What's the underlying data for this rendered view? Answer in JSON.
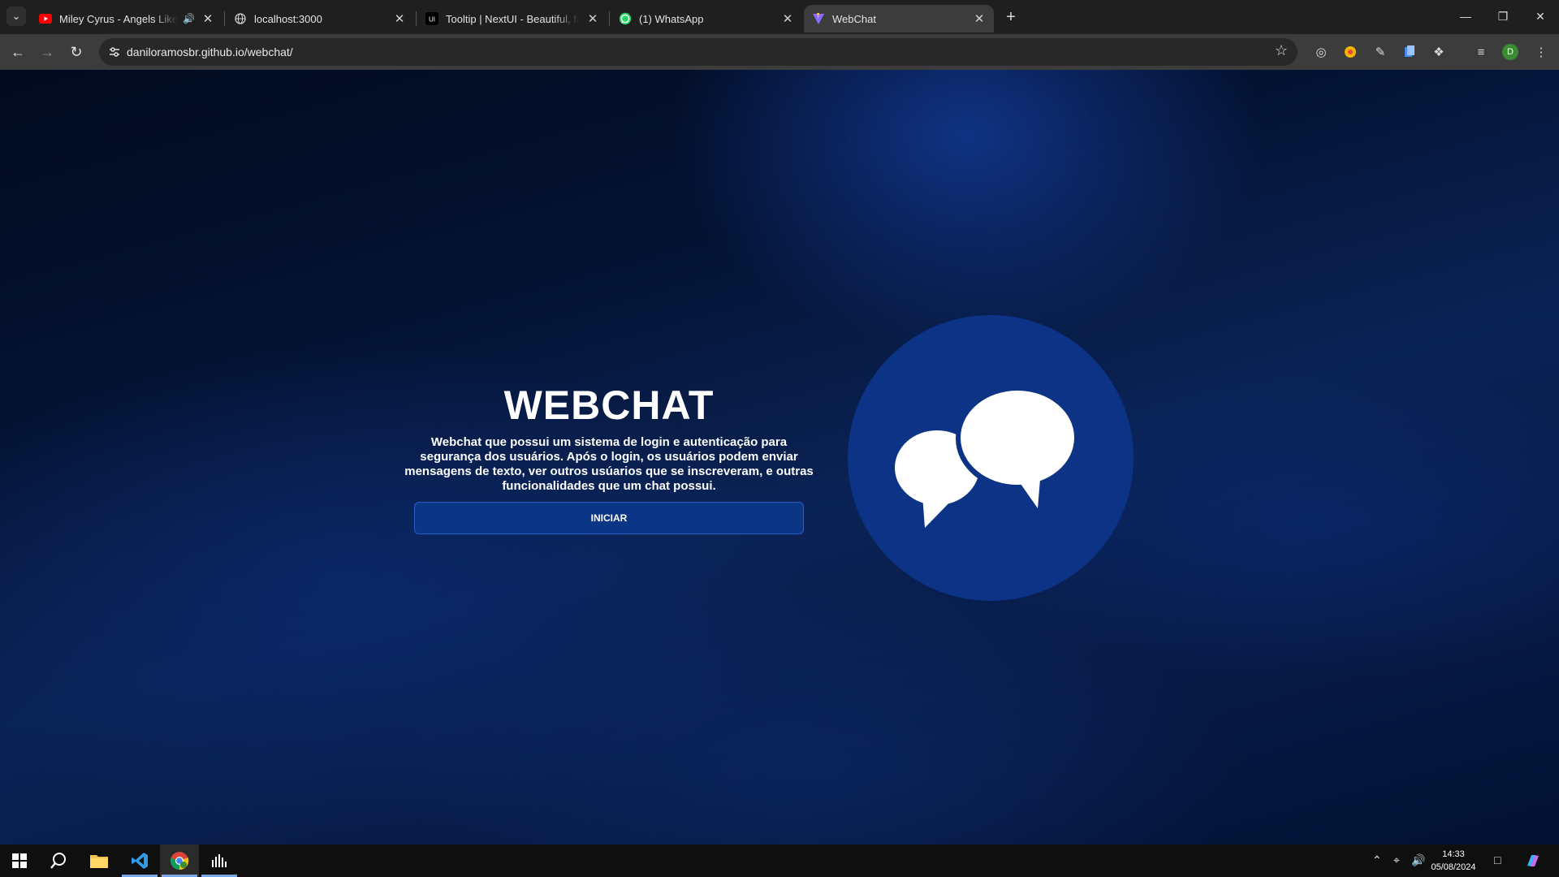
{
  "browser": {
    "tabs": [
      {
        "title": "Miley Cyrus - Angels Like You",
        "icon": "youtube-icon",
        "audio": "speaker-icon"
      },
      {
        "title": "localhost:3000",
        "icon": "globe-icon"
      },
      {
        "title": "Tooltip | NextUI - Beautiful, fast",
        "icon": "nextui-icon"
      },
      {
        "title": "(1) WhatsApp",
        "icon": "whatsapp-icon"
      },
      {
        "title": "WebChat",
        "icon": "vite-icon",
        "active": true
      }
    ],
    "url": "daniloramosbr.github.io/webchat/",
    "profile_initial": "D"
  },
  "page": {
    "title": "WEBCHAT",
    "description": "Webchat que possui um sistema de login e autenticação para segurança dos usuários. Após o login, os usuários podem enviar mensagens de texto, ver outros usúarios que se inscreveram, e outras funcionalidades que um chat possui.",
    "button_label": "INICIAR",
    "logo": "chat-bubbles-icon",
    "colors": {
      "accent": "#0b3585",
      "logo_circle": "#0d3386",
      "background": "#041333"
    }
  },
  "taskbar": {
    "time": "14:33",
    "date": "05/08/2024"
  }
}
